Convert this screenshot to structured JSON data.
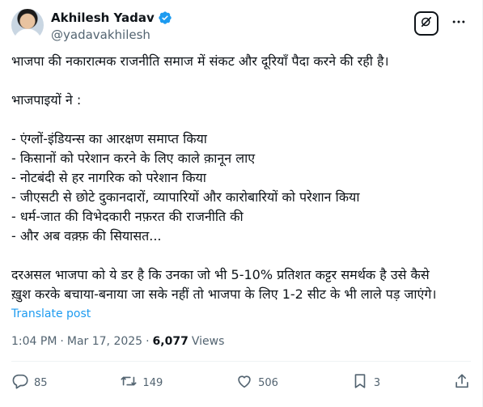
{
  "author": {
    "display_name": "Akhilesh Yadav",
    "handle": "@yadavakhilesh"
  },
  "post": {
    "lines": [
      "भाजपा की नकारात्मक राजनीति समाज में संकट और दूरियाँ पैदा करने की रही है।",
      "",
      "भाजपाइयों ने :",
      "",
      "- एंग्लों-इंडियन्स का आरक्षण समाप्त किया",
      "- किसानों को परेशान करने के लिए काले क़ानून लाए",
      "- नोटबंदी से हर नागरिक को परेशान किया",
      "- जीएसटी से छोटे दुकानदारों, व्यापारियों और कारोबारियों को परेशान किया",
      "- धर्म-जात की विभेदकारी नफ़रत की राजनीति की",
      "- और अब वक़्फ़ की सियासत...",
      "",
      "दरअसल भाजपा को ये डर है कि उनका जो भी 5-10% प्रतिशत कट्टर समर्थक है उसे कैसे",
      "ख़ुश करके बचाया-बनाया जा सके नहीं तो भाजपा के लिए 1-2 सीट के भी लाले पड़ जाएंगे।"
    ],
    "translate_label": "Translate post",
    "time": "1:04 PM",
    "date": "Mar 17, 2025",
    "separator": "·",
    "views_count": "6,077",
    "views_label": "Views"
  },
  "actions": {
    "replies": "85",
    "reposts": "149",
    "likes": "506",
    "bookmarks": "3"
  },
  "icons": [
    "verified-badge-icon",
    "grok-icon",
    "more-icon",
    "reply-icon",
    "repost-icon",
    "like-icon",
    "bookmark-icon",
    "share-icon"
  ],
  "colors": {
    "accent": "#1d9bf0",
    "secondary_text": "#536471",
    "primary_text": "#0f1419"
  }
}
